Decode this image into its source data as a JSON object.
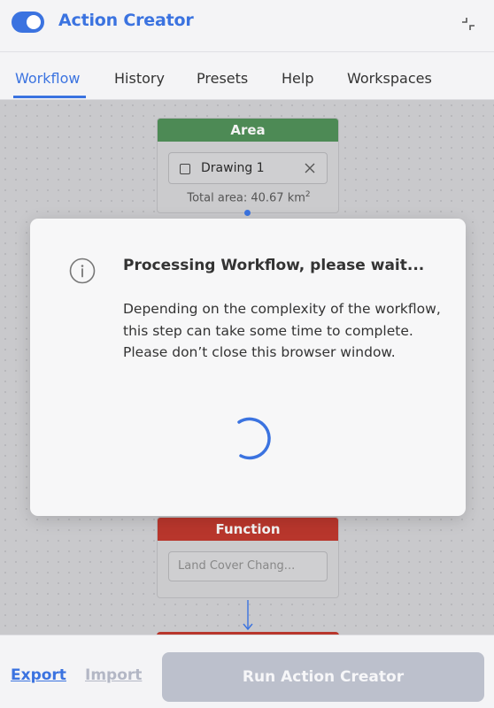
{
  "header": {
    "title": "Action Creator",
    "toggle_on": true,
    "accent_color": "#3b73e0"
  },
  "tabs": [
    {
      "label": "Workflow",
      "active": true
    },
    {
      "label": "History",
      "active": false
    },
    {
      "label": "Presets",
      "active": false
    },
    {
      "label": "Help",
      "active": false
    },
    {
      "label": "Workspaces",
      "active": false
    }
  ],
  "canvas": {
    "area_node": {
      "title": "Area",
      "color": "#4d8a55",
      "drawing_label": "Drawing 1",
      "total_area_text": "Total area: 40.67 km",
      "total_area_unit_sup": "2"
    },
    "function_node": {
      "title": "Function",
      "color": "#b8362c",
      "placeholder": "Land Cover Chang..."
    }
  },
  "modal": {
    "icon": "info-icon",
    "title": "Processing Workflow, please wait...",
    "body": "Depending on the complexity of the workflow, this step can take some time to complete. Please don’t close this browser window.",
    "spinner": "loading-spinner"
  },
  "footer": {
    "export_label": "Export",
    "import_label": "Import",
    "run_label": "Run Action Creator"
  }
}
